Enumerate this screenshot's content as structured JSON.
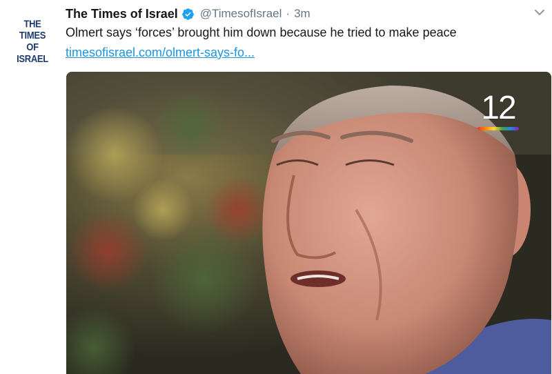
{
  "account": {
    "avatar_lines": [
      "THE TIMES",
      "OF ISRAEL"
    ],
    "name": "The Times of Israel",
    "handle": "@TimesofIsrael",
    "separator": "·",
    "time": "3m",
    "verified": true,
    "verified_color": "#1da1f2"
  },
  "tweet": {
    "text": "Olmert says ‘forces’ brought him down because he tried to make peace",
    "link": "timesofisrael.com/olmert-says-fo..."
  },
  "media": {
    "channel_badge": "12",
    "description_icon": "tv-channel-12-logo"
  },
  "colors": {
    "name": "#14171a",
    "meta": "#657786",
    "link": "#1b95e0",
    "avatar": "#1f3a6e"
  }
}
